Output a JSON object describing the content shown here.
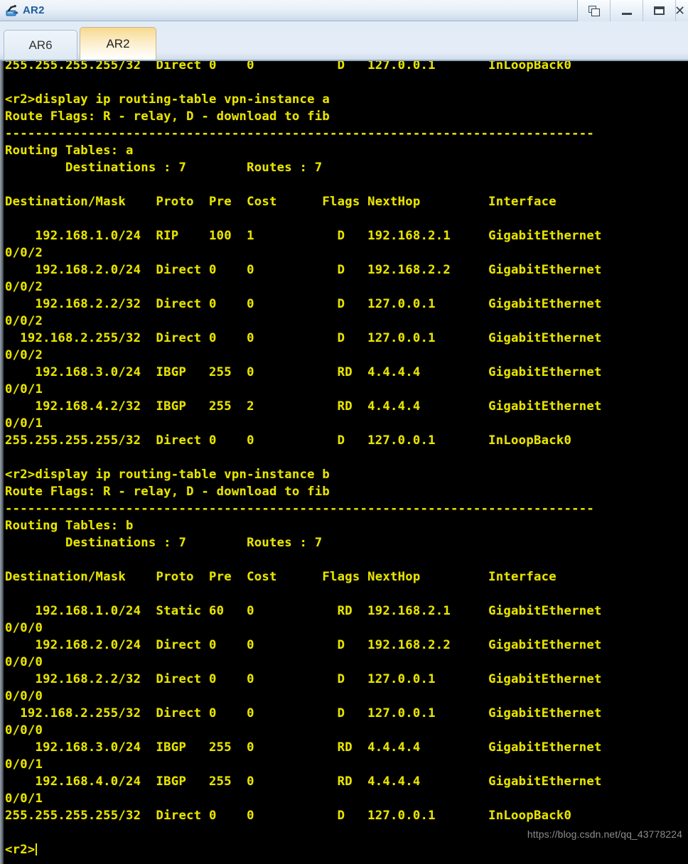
{
  "window": {
    "title": "AR2",
    "icon": "router-icon",
    "controls": [
      {
        "name": "restore-button",
        "label": "Restore"
      },
      {
        "name": "minimize-button",
        "label": "Minimize"
      },
      {
        "name": "maximize-button",
        "label": "Maximize"
      },
      {
        "name": "close-button",
        "label": "✕"
      }
    ]
  },
  "tabs": [
    {
      "label": "AR6",
      "active": false
    },
    {
      "label": "AR2",
      "active": true
    }
  ],
  "terminal": {
    "prompt": "<r2>",
    "colors": {
      "background": "#000000",
      "text": "#e8e400"
    },
    "commands": [
      "display ip routing-table vpn-instance a",
      "display ip routing-table vpn-instance b"
    ],
    "route_flags_legend": "Route Flags: R - relay, D - download to fib",
    "separator": "------------------------------------------------------------------------------",
    "columns": [
      "Destination/Mask",
      "Proto",
      "Pre",
      "Cost",
      "Flags",
      "NextHop",
      "Interface"
    ],
    "header_line": "Destination/Mask    Proto  Pre  Cost      Flags NextHop         Interface",
    "scrollback_top_line": "255.255.255.255/32  Direct 0    0           D   127.0.0.1       InLoopBack0",
    "sections": [
      {
        "vpn_instance": "a",
        "table_title": "Routing Tables: a",
        "summary": "        Destinations : 7        Routes : 7",
        "destinations": "7",
        "routes": "7",
        "rows": [
          {
            "destination": "192.168.1.0/24",
            "proto": "RIP",
            "pre": "100",
            "cost": "1",
            "flags": "D",
            "nexthop": "192.168.2.1",
            "interface": "GigabitEthernet0/0/2"
          },
          {
            "destination": "192.168.2.0/24",
            "proto": "Direct",
            "pre": "0",
            "cost": "0",
            "flags": "D",
            "nexthop": "192.168.2.2",
            "interface": "GigabitEthernet0/0/2"
          },
          {
            "destination": "192.168.2.2/32",
            "proto": "Direct",
            "pre": "0",
            "cost": "0",
            "flags": "D",
            "nexthop": "127.0.0.1",
            "interface": "GigabitEthernet0/0/2"
          },
          {
            "destination": "192.168.2.255/32",
            "proto": "Direct",
            "pre": "0",
            "cost": "0",
            "flags": "D",
            "nexthop": "127.0.0.1",
            "interface": "GigabitEthernet0/0/2"
          },
          {
            "destination": "192.168.3.0/24",
            "proto": "IBGP",
            "pre": "255",
            "cost": "0",
            "flags": "RD",
            "nexthop": "4.4.4.4",
            "interface": "GigabitEthernet0/0/1"
          },
          {
            "destination": "192.168.4.2/32",
            "proto": "IBGP",
            "pre": "255",
            "cost": "2",
            "flags": "RD",
            "nexthop": "4.4.4.4",
            "interface": "GigabitEthernet0/0/1"
          },
          {
            "destination": "255.255.255.255/32",
            "proto": "Direct",
            "pre": "0",
            "cost": "0",
            "flags": "D",
            "nexthop": "127.0.0.1",
            "interface": "InLoopBack0"
          }
        ]
      },
      {
        "vpn_instance": "b",
        "table_title": "Routing Tables: b",
        "summary": "        Destinations : 7        Routes : 7",
        "destinations": "7",
        "routes": "7",
        "rows": [
          {
            "destination": "192.168.1.0/24",
            "proto": "Static",
            "pre": "60",
            "cost": "0",
            "flags": "RD",
            "nexthop": "192.168.2.1",
            "interface": "GigabitEthernet0/0/0"
          },
          {
            "destination": "192.168.2.0/24",
            "proto": "Direct",
            "pre": "0",
            "cost": "0",
            "flags": "D",
            "nexthop": "192.168.2.2",
            "interface": "GigabitEthernet0/0/0"
          },
          {
            "destination": "192.168.2.2/32",
            "proto": "Direct",
            "pre": "0",
            "cost": "0",
            "flags": "D",
            "nexthop": "127.0.0.1",
            "interface": "GigabitEthernet0/0/0"
          },
          {
            "destination": "192.168.2.255/32",
            "proto": "Direct",
            "pre": "0",
            "cost": "0",
            "flags": "D",
            "nexthop": "127.0.0.1",
            "interface": "GigabitEthernet0/0/0"
          },
          {
            "destination": "192.168.3.0/24",
            "proto": "IBGP",
            "pre": "255",
            "cost": "0",
            "flags": "RD",
            "nexthop": "4.4.4.4",
            "interface": "GigabitEthernet0/0/1"
          },
          {
            "destination": "192.168.4.0/24",
            "proto": "IBGP",
            "pre": "255",
            "cost": "0",
            "flags": "RD",
            "nexthop": "4.4.4.4",
            "interface": "GigabitEthernet0/0/1"
          },
          {
            "destination": "255.255.255.255/32",
            "proto": "Direct",
            "pre": "0",
            "cost": "0",
            "flags": "D",
            "nexthop": "127.0.0.1",
            "interface": "InLoopBack0"
          }
        ]
      }
    ],
    "console_text": "255.255.255.255/32  Direct 0    0           D   127.0.0.1       InLoopBack0\n\n<r2>display ip routing-table vpn-instance a\nRoute Flags: R - relay, D - download to fib\n------------------------------------------------------------------------------\nRouting Tables: a\n        Destinations : 7        Routes : 7\n\nDestination/Mask    Proto  Pre  Cost      Flags NextHop         Interface\n\n    192.168.1.0/24  RIP    100  1           D   192.168.2.1     GigabitEthernet\n0/0/2\n    192.168.2.0/24  Direct 0    0           D   192.168.2.2     GigabitEthernet\n0/0/2\n    192.168.2.2/32  Direct 0    0           D   127.0.0.1       GigabitEthernet\n0/0/2\n  192.168.2.255/32  Direct 0    0           D   127.0.0.1       GigabitEthernet\n0/0/2\n    192.168.3.0/24  IBGP   255  0           RD  4.4.4.4         GigabitEthernet\n0/0/1\n    192.168.4.2/32  IBGP   255  2           RD  4.4.4.4         GigabitEthernet\n0/0/1\n255.255.255.255/32  Direct 0    0           D   127.0.0.1       InLoopBack0\n\n<r2>display ip routing-table vpn-instance b\nRoute Flags: R - relay, D - download to fib\n------------------------------------------------------------------------------\nRouting Tables: b\n        Destinations : 7        Routes : 7\n\nDestination/Mask    Proto  Pre  Cost      Flags NextHop         Interface\n\n    192.168.1.0/24  Static 60   0           RD  192.168.2.1     GigabitEthernet\n0/0/0\n    192.168.2.0/24  Direct 0    0           D   192.168.2.2     GigabitEthernet\n0/0/0\n    192.168.2.2/32  Direct 0    0           D   127.0.0.1       GigabitEthernet\n0/0/0\n  192.168.2.255/32  Direct 0    0           D   127.0.0.1       GigabitEthernet\n0/0/0\n    192.168.3.0/24  IBGP   255  0           RD  4.4.4.4         GigabitEthernet\n0/0/1\n    192.168.4.0/24  IBGP   255  0           RD  4.4.4.4         GigabitEthernet\n0/0/1\n255.255.255.255/32  Direct 0    0           D   127.0.0.1       InLoopBack0\n\n<r2>"
  },
  "watermark": "https://blog.csdn.net/qq_43778224"
}
